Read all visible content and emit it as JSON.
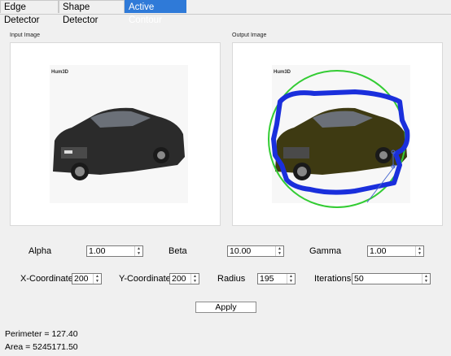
{
  "tabs": [
    {
      "label": "Edge Detector",
      "active": false
    },
    {
      "label": "Shape Detector",
      "active": false
    },
    {
      "label": "Active Contour",
      "active": true
    }
  ],
  "input_panel": {
    "title": "Input Image",
    "watermark": "Hum3D"
  },
  "output_panel": {
    "title": "Output Image",
    "watermark": "Hum3D"
  },
  "params": {
    "alpha": {
      "label": "Alpha",
      "value": "1.00"
    },
    "beta": {
      "label": "Beta",
      "value": "10.00"
    },
    "gamma": {
      "label": "Gamma",
      "value": "1.00"
    },
    "x_coordinate": {
      "label": "X-Coordinate",
      "value": "200"
    },
    "y_coordinate": {
      "label": "Y-Coordinate",
      "value": "200"
    },
    "radius": {
      "label": "Radius",
      "value": "195"
    },
    "iterations": {
      "label": "Iterations",
      "value": "50"
    }
  },
  "apply_label": "Apply",
  "results": {
    "perimeter": "Perimeter = 127.40",
    "area": "Area = 5245171.50"
  },
  "colors": {
    "accent": "#2f7ad8",
    "circle": "#33cc33",
    "contour": "#1a2fdc"
  }
}
